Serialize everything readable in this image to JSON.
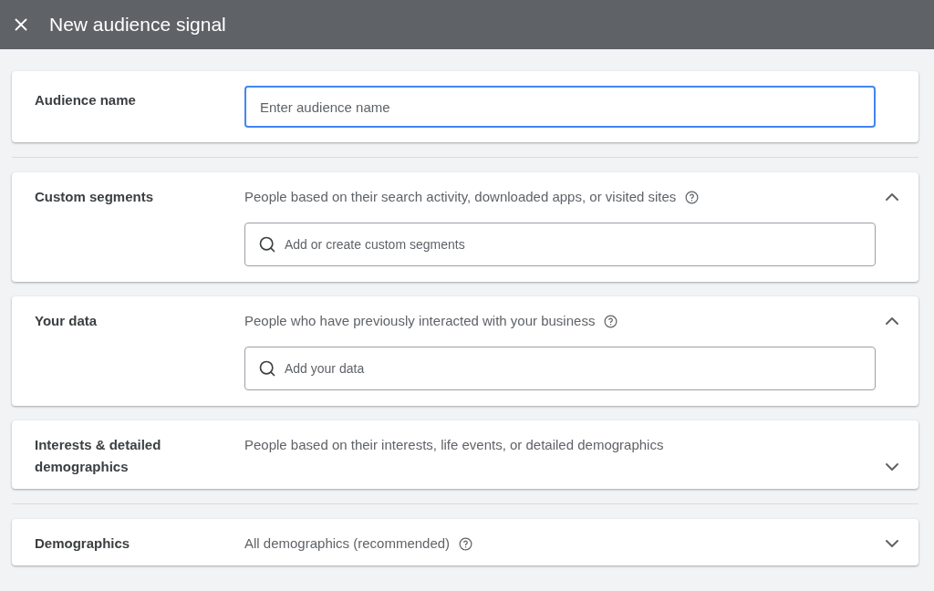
{
  "window": {
    "title": "New audience signal"
  },
  "groups": [
    {
      "sections": [
        {
          "kind": "name_input",
          "label": "Audience name",
          "placeholder": "Enter audience name",
          "focused": true
        }
      ]
    },
    {
      "sections": [
        {
          "kind": "section",
          "label": "Custom segments",
          "description": "People based on their search activity, downloaded apps, or visited sites",
          "help": true,
          "expanded": true,
          "placeholder": "Add or create custom segments"
        },
        {
          "kind": "section",
          "label": "Your data",
          "description": "People who have previously interacted with your business",
          "help": true,
          "expanded": true,
          "placeholder": "Add your data"
        },
        {
          "kind": "section",
          "label": "Interests & detailed demographics",
          "description": "People based on their interests, life events, or detailed demographics",
          "help": false,
          "expanded": false
        }
      ]
    },
    {
      "sections": [
        {
          "kind": "section",
          "label": "Demographics",
          "description": "All demographics (recommended)",
          "help": true,
          "expanded": false
        }
      ]
    }
  ]
}
